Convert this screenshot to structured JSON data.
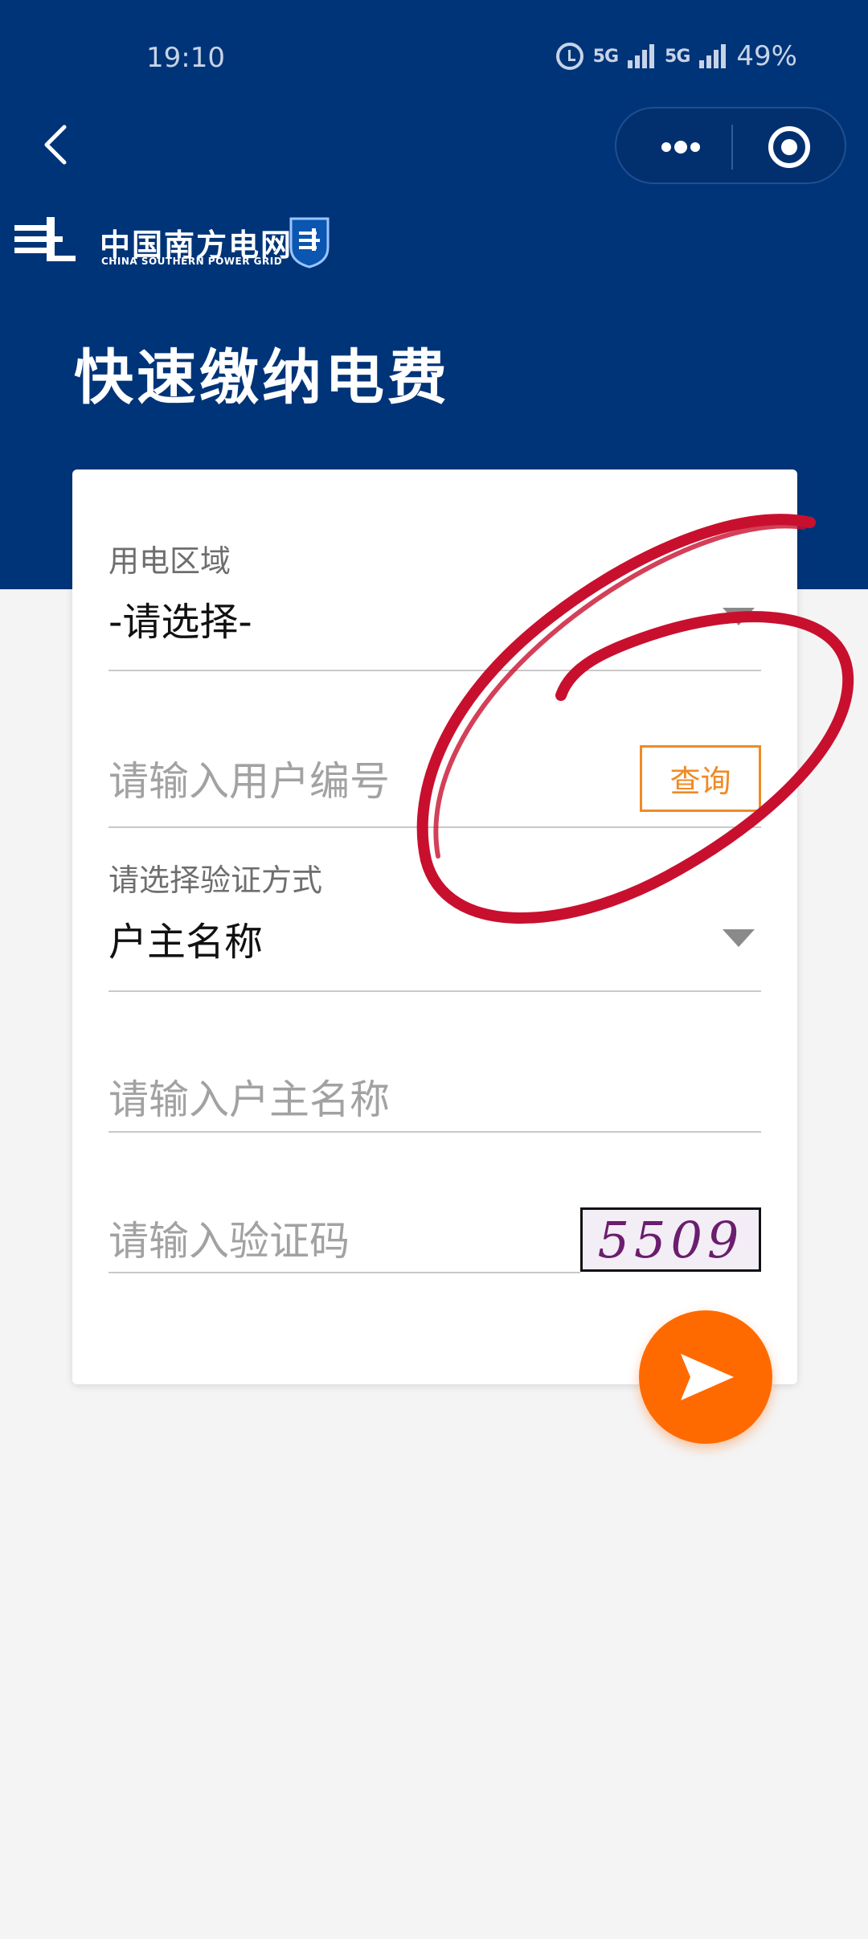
{
  "status_bar": {
    "time": "19:10",
    "signal_1": "5G",
    "signal_2": "5G",
    "battery": "49%"
  },
  "nav": {
    "back_icon": "chevron-left-icon",
    "more_icon": "more-dots-icon",
    "close_icon": "target-close-icon"
  },
  "brand": {
    "name_cn": "中国南方电网",
    "name_en": "CHINA SOUTHERN POWER GRID"
  },
  "page": {
    "title": "快速缴纳电费"
  },
  "form": {
    "region": {
      "label": "用电区域",
      "value": "-请选择-"
    },
    "user_number": {
      "placeholder": "请输入用户编号",
      "query_label": "查询"
    },
    "verify_method": {
      "label": "请选择验证方式",
      "value": "户主名称"
    },
    "owner_name": {
      "placeholder": "请输入户主名称"
    },
    "captcha": {
      "placeholder": "请输入验证码",
      "code": "5509"
    },
    "submit_icon": "send-arrow-icon"
  },
  "colors": {
    "header_blue": "#003479",
    "accent_orange": "#ff6a00",
    "query_orange": "#f08a24",
    "annotation_red": "#c8102e"
  }
}
